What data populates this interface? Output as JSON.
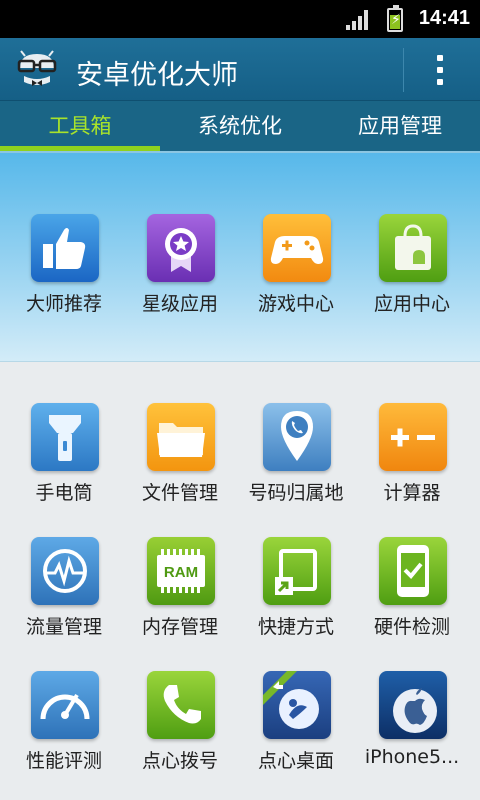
{
  "status_bar": {
    "time": "14:41"
  },
  "app_bar": {
    "title": "安卓优化大师"
  },
  "tabs": [
    {
      "label": "工具箱"
    },
    {
      "label": "系统优化"
    },
    {
      "label": "应用管理"
    }
  ],
  "featured": [
    {
      "label": "大师推荐",
      "icon": "thumbs-up-icon"
    },
    {
      "label": "星级应用",
      "icon": "star-badge-icon"
    },
    {
      "label": "游戏中心",
      "icon": "gamepad-icon"
    },
    {
      "label": "应用中心",
      "icon": "app-bag-icon"
    }
  ],
  "tools": [
    {
      "label": "手电筒",
      "icon": "flashlight-icon"
    },
    {
      "label": "文件管理",
      "icon": "folder-icon"
    },
    {
      "label": "号码归属地",
      "icon": "phone-location-icon"
    },
    {
      "label": "计算器",
      "icon": "calculator-icon"
    },
    {
      "label": "流量管理",
      "icon": "traffic-icon"
    },
    {
      "label": "内存管理",
      "icon": "ram-icon",
      "icon_text": "RAM"
    },
    {
      "label": "快捷方式",
      "icon": "shortcut-icon"
    },
    {
      "label": "硬件检测",
      "icon": "hardware-check-icon"
    },
    {
      "label": "性能评测",
      "icon": "speedometer-icon"
    },
    {
      "label": "点心拨号",
      "icon": "dialer-icon"
    },
    {
      "label": "点心桌面",
      "icon": "desktop-icon"
    },
    {
      "label": "iPhone5...",
      "icon": "apple-icon"
    }
  ],
  "colors": {
    "app_bar": "#1a6586",
    "tab_active": "#a8e32b",
    "featured_top": "#57b8ea"
  }
}
